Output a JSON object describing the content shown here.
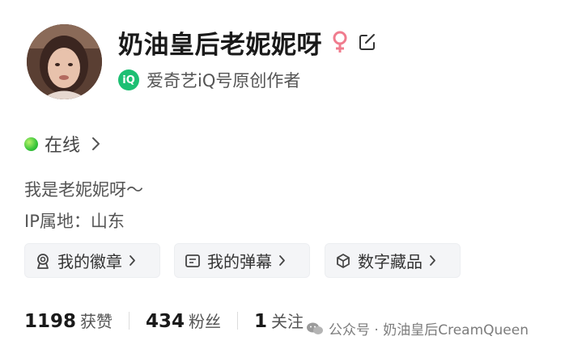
{
  "profile": {
    "name": "奶油皇后老妮妮呀",
    "certification": "爱奇艺iQ号原创作者",
    "iq_badge": "iQ",
    "online_status": "在线",
    "bio": "我是老妮妮呀～",
    "ip_location": "IP属地：山东"
  },
  "chips": [
    {
      "label": "我的徽章",
      "icon": "badge-icon"
    },
    {
      "label": "我的弹幕",
      "icon": "danmaku-icon"
    },
    {
      "label": "数字藏品",
      "icon": "collectible-icon"
    }
  ],
  "stats": [
    {
      "value": "1198",
      "label": "获赞"
    },
    {
      "value": "434",
      "label": "粉丝"
    },
    {
      "value": "1",
      "label": "关注"
    }
  ],
  "watermark": "公众号 · 奶油皇后CreamQueen",
  "colors": {
    "iq_green": "#1dbf73",
    "female_icon": "#f07c8e",
    "online_green": "#37c43a",
    "chip_bg": "#f4f5f7"
  }
}
